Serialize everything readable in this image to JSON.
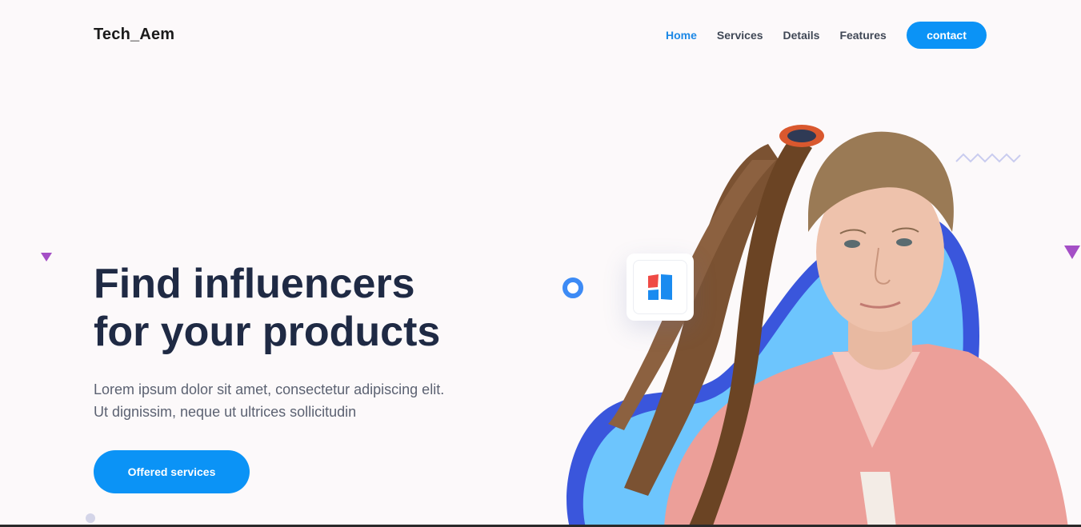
{
  "header": {
    "logo": "Tech_Aem",
    "nav": [
      {
        "label": "Home",
        "active": true
      },
      {
        "label": "Services",
        "active": false
      },
      {
        "label": "Details",
        "active": false
      },
      {
        "label": "Features",
        "active": false
      }
    ],
    "contact_label": "contact"
  },
  "hero": {
    "title_line1": "Find influencers",
    "title_line2": "for your products",
    "desc_line1": "Lorem ipsum dolor sit amet, consectetur adipiscing elit.",
    "desc_line2": "Ut dignissim, neque ut ultrices sollicitudin",
    "cta_label": "Offered services"
  },
  "icons": {
    "app_card": "app-logo-icon",
    "decorations": [
      "triangle-icon",
      "ring-icon",
      "zigzag-icon",
      "dot-icon"
    ]
  },
  "colors": {
    "accent": "#0b93f6",
    "active_nav": "#1c88e6",
    "headline": "#1f2a44",
    "triangle": "#a44fc6",
    "blob_light": "#6dc5fd",
    "blob_dark": "#3a56dc"
  }
}
